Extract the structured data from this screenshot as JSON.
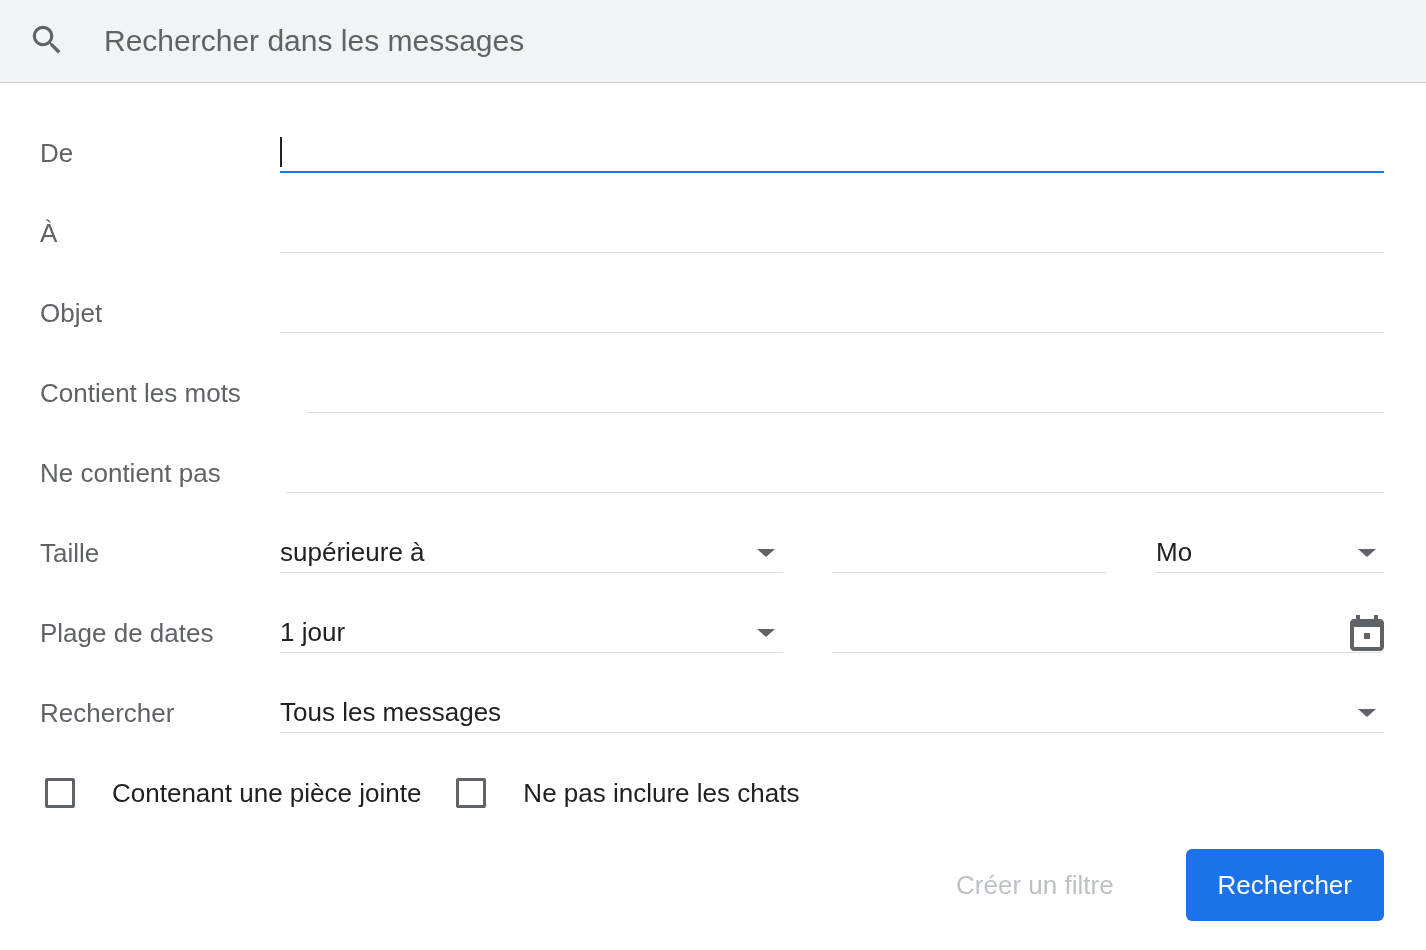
{
  "search_bar": {
    "placeholder": "Rechercher dans les messages"
  },
  "fields": [
    {
      "kind": "text",
      "label": "De",
      "focused": true
    },
    {
      "kind": "text",
      "label": "À",
      "focused": false
    },
    {
      "kind": "text",
      "label": "Objet",
      "focused": false
    },
    {
      "kind": "text",
      "label": "Contient les mots",
      "focused": false
    },
    {
      "kind": "text",
      "label": "Ne contient pas",
      "focused": false
    },
    {
      "kind": "size",
      "label": "Taille",
      "comparator": "supérieure à",
      "unit": "Mo"
    },
    {
      "kind": "date",
      "label": "Plage de dates",
      "range": "1 jour"
    },
    {
      "kind": "select",
      "label": "Rechercher",
      "value": "Tous les messages"
    }
  ],
  "checkboxes": [
    {
      "label": "Contenant une pièce jointe",
      "checked": false
    },
    {
      "label": "Ne pas inclure les chats",
      "checked": false
    }
  ],
  "buttons": [
    {
      "kind": "text",
      "label": "Créer un filtre",
      "disabled": true
    },
    {
      "kind": "primary",
      "label": "Rechercher",
      "disabled": false
    }
  ]
}
